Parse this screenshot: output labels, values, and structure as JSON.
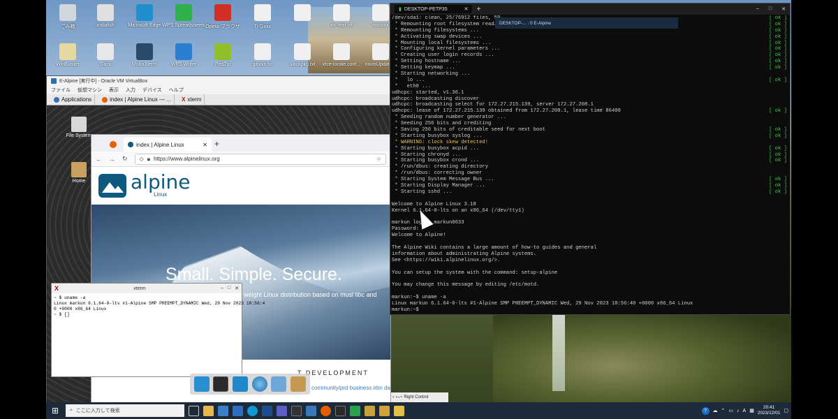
{
  "desktop": {
    "icons_row1": [
      "ごみ箱",
      "installsh",
      "Microsoft Edge",
      "WPS Spreadsheets",
      "Opera ブラウザ",
      "ひなxxx",
      "",
      "ini_text.txt",
      "nixosxx"
    ],
    "icons_row2": [
      "WinBlaster",
      "Slack",
      "MobaXterm",
      "WPS Writer",
      "PeaZip",
      "gitlxxx.txt",
      "slackpkg.txt",
      "xfce-locale.conf...",
      "nixosUpdate..."
    ],
    "colors": {
      "taskbar": "#1d2a3a",
      "terminal_bg": "#0c0c0c",
      "ok_green": "#3fd14f"
    }
  },
  "vbox": {
    "title": "E-Alpine [実行中] - Oracle VM VirtualBox",
    "menu": [
      "ファイル",
      "仮想マシン",
      "表示",
      "入力",
      "デバイス",
      "ヘルプ"
    ],
    "panel": {
      "applications": "Applications",
      "tab1": "index | Alpine Linux — ...",
      "tab2": "xterm"
    },
    "guest_icons": [
      "File System",
      "Home"
    ],
    "status_right": "Right Control"
  },
  "firefox": {
    "tab_title": "index | Alpine Linux",
    "url": "https://www.alpinelinux.org",
    "logo_text": "alpine",
    "logo_sub": "Linux",
    "hero_title": "Small. Simple. Secure.",
    "hero_sub": "weight Linux distribution based on musl libc and",
    "dev_heading": "T DEVELOPMENT",
    "dev_links": "community/prd business irbn data up"
  },
  "xterm": {
    "title": "xterm",
    "lines": [
      "~ $ uname -a",
      "Linux markun 6.1.64-0-lts #1-Alpine SMP PREEMPT_DYNAMIC Wed, 29 Nov 2023 18:56:4",
      "0 +0000 x86_64 Linux",
      "~ $ []"
    ]
  },
  "terminal": {
    "window_title": "DESKTOP-PETP35",
    "sub_title": "DESKTOP-... : 0 E-Alpine",
    "boot": [
      {
        "t": "/dev/sda1: clean, 25/76912 files, 59...",
        "s": "ok"
      },
      {
        "t": " * Remounting root filesystem read/write ...",
        "s": "ok"
      },
      {
        "t": " * Remounting filesystems ...",
        "s": "ok"
      },
      {
        "t": " * Activating swap devices ...",
        "s": "ok"
      },
      {
        "t": " * Mounting local filesystems ...",
        "s": "ok"
      },
      {
        "t": " * Configuring kernel parameters ...",
        "s": "ok"
      },
      {
        "t": " * Creating user login records ...",
        "s": "ok"
      },
      {
        "t": " * Setting hostname ...",
        "s": "ok"
      },
      {
        "t": " * Setting keymap ...",
        "s": "ok"
      },
      {
        "t": " * Starting networking ...",
        "s": ""
      },
      {
        "t": " *   lo ...",
        "s": "ok"
      },
      {
        "t": " *   eth0 ...",
        "s": ""
      },
      {
        "t": "udhcpc: started, v1.36.1",
        "s": ""
      },
      {
        "t": "udhcpc: broadcasting discover",
        "s": ""
      },
      {
        "t": "udhcpc: broadcasting select for 172.27.215.139, server 172.27.208.1",
        "s": ""
      },
      {
        "t": "udhcpc: lease of 172.27.215.139 obtained from 172.27.208.1, lease time 86400",
        "s": "ok"
      },
      {
        "t": " * Seeding random number generator ...",
        "s": ""
      },
      {
        "t": " * Seeding 256 bits and crediting",
        "s": ""
      },
      {
        "t": " * Saving 256 bits of creditable seed for next boot",
        "s": "ok"
      },
      {
        "t": " * Starting busybox syslog ...",
        "s": "ok"
      },
      {
        "t": " * WARNING: clock skew detected!",
        "s": ""
      },
      {
        "t": " * Starting busybox acpid ...",
        "s": "ok"
      },
      {
        "t": " * Starting chronyd ...",
        "s": "ok"
      },
      {
        "t": " * Starting busybox crond ...",
        "s": "ok"
      },
      {
        "t": " * /run/dbus: creating directory",
        "s": ""
      },
      {
        "t": " * /run/dbus: correcting owner",
        "s": ""
      },
      {
        "t": " * Starting System Message Bus ...",
        "s": "ok"
      },
      {
        "t": " * Starting Display Manager ...",
        "s": "ok"
      },
      {
        "t": " * Starting sshd ...",
        "s": "ok"
      },
      {
        "t": "",
        "s": ""
      },
      {
        "t": "Welcome to Alpine Linux 3.18",
        "s": ""
      },
      {
        "t": "Kernel 6.1.64-0-lts on an x86_64 (/dev/tty1)",
        "s": ""
      },
      {
        "t": "",
        "s": ""
      },
      {
        "t": "markun login: markun0633",
        "s": ""
      },
      {
        "t": "Password:",
        "s": ""
      },
      {
        "t": "Welcome to Alpine!",
        "s": ""
      },
      {
        "t": "",
        "s": ""
      },
      {
        "t": "The Alpine Wiki contains a large amount of how-to guides and general",
        "s": ""
      },
      {
        "t": "information about administrating Alpine systems.",
        "s": ""
      },
      {
        "t": "See <https://wiki.alpinelinux.org/>.",
        "s": ""
      },
      {
        "t": "",
        "s": ""
      },
      {
        "t": "You can setup the system with the command: setup-alpine",
        "s": ""
      },
      {
        "t": "",
        "s": ""
      },
      {
        "t": "You may change this message by editing /etc/motd.",
        "s": ""
      },
      {
        "t": "",
        "s": ""
      },
      {
        "t": "markun:~$ uname -a",
        "s": ""
      },
      {
        "t": "Linux markun 6.1.64-0-lts #1-Alpine SMP PREEMPT_DYNAMIC Wed, 29 Nov 2023 18:56:40 +0000 x86_64 Linux",
        "s": ""
      },
      {
        "t": "markun:~$",
        "s": ""
      }
    ],
    "ok_text": "[ ok ]"
  },
  "taskbar": {
    "search_placeholder": "ここに入力して検索",
    "time": "20:41",
    "date": "2023/12/01",
    "ime": "A"
  }
}
